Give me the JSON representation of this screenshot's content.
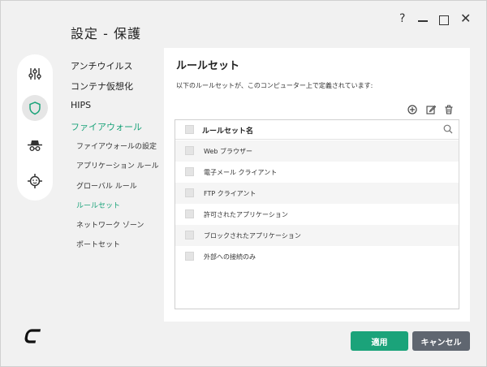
{
  "window": {
    "title": "設定 - 保護",
    "help_glyph": "?",
    "close_glyph": "✕"
  },
  "iconbar": {
    "icons": [
      "sliders-icon",
      "shield-icon",
      "spy-icon",
      "target-icon"
    ],
    "active": "shield-icon"
  },
  "nav": {
    "items": [
      {
        "label": "アンチウイルス",
        "level": 1
      },
      {
        "label": "コンテナ仮想化",
        "level": 1
      },
      {
        "label": "HIPS",
        "level": 1
      },
      {
        "label": "ファイアウォール",
        "level": 1,
        "active": true
      },
      {
        "label": "ファイアウォールの設定",
        "level": 2
      },
      {
        "label": "アプリケーション ルール",
        "level": 2
      },
      {
        "label": "グローバル ルール",
        "level": 2
      },
      {
        "label": "ルールセット",
        "level": 2,
        "active": true
      },
      {
        "label": "ネットワーク ゾーン",
        "level": 2
      },
      {
        "label": "ポートセット",
        "level": 2
      }
    ]
  },
  "panel": {
    "title": "ルールセット",
    "description": "以下のルールセットが、このコンピューター上で定義されています:",
    "toolbar": [
      "add-icon",
      "edit-icon",
      "delete-icon"
    ],
    "table": {
      "header": "ルールセット名",
      "rows": [
        "Web ブラウザー",
        "電子メール クライアント",
        "FTP クライアント",
        "許可されたアプリケーション",
        "ブロックされたアプリケーション",
        "外部への接続のみ"
      ]
    }
  },
  "footer": {
    "logo": "C",
    "apply_label": "適用",
    "cancel_label": "キャンセル"
  },
  "colors": {
    "accent": "#1ba37a",
    "cancel": "#5f6670"
  }
}
